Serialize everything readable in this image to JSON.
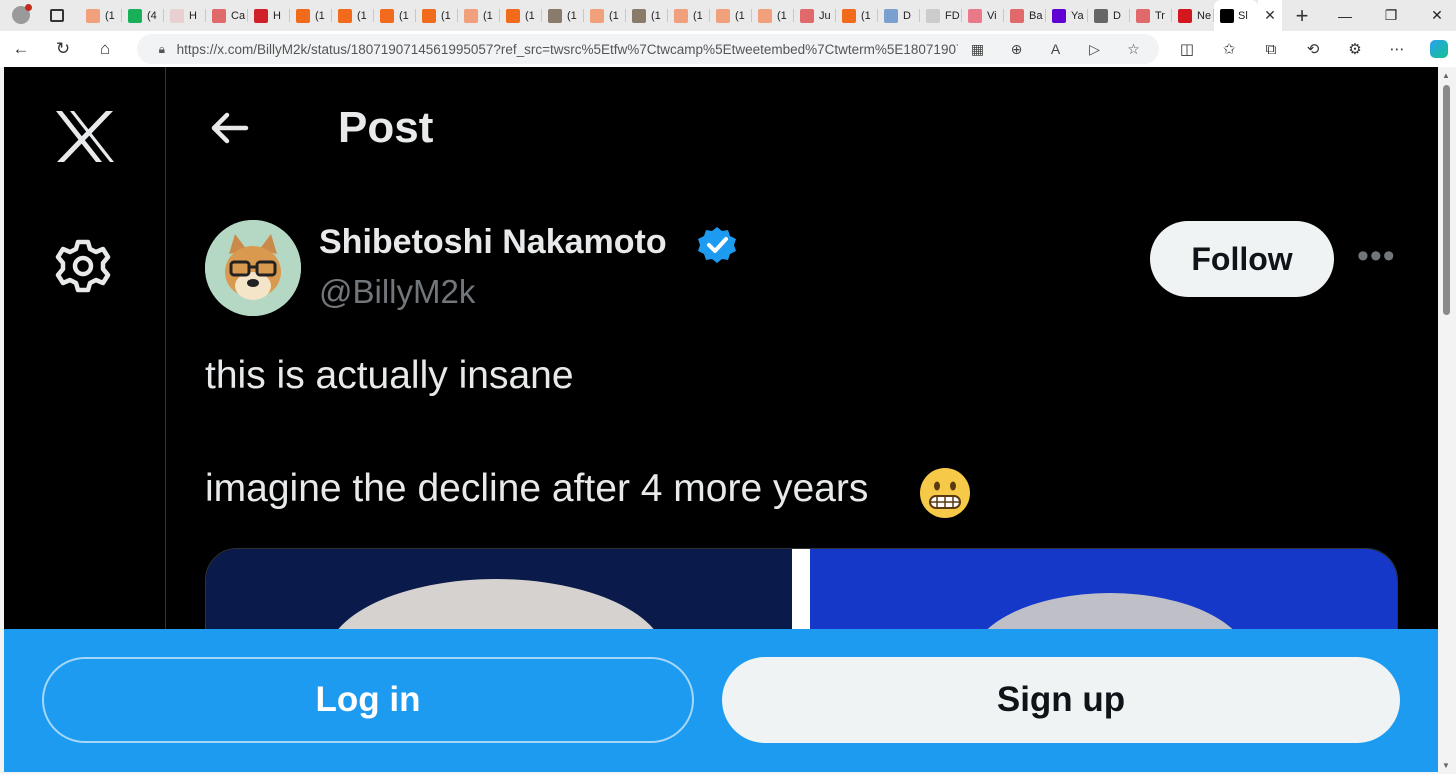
{
  "browser": {
    "tabs": [
      {
        "short": "(1",
        "favicon_color": "#f0a07a"
      },
      {
        "short": "(4",
        "favicon_color": "#18b15a"
      },
      {
        "short": "H",
        "favicon_color": "#e8d0d0"
      },
      {
        "short": "Ca",
        "favicon_color": "#e06a6a"
      },
      {
        "short": "H",
        "favicon_color": "#d0202a"
      },
      {
        "short": "(1",
        "favicon_color": "#f26a1b"
      },
      {
        "short": "(1",
        "favicon_color": "#f26a1b"
      },
      {
        "short": "(1",
        "favicon_color": "#f26a1b"
      },
      {
        "short": "(1",
        "favicon_color": "#f26a1b"
      },
      {
        "short": "(1",
        "favicon_color": "#f0a07a"
      },
      {
        "short": "(1",
        "favicon_color": "#f26a1b"
      },
      {
        "short": "(1",
        "favicon_color": "#8a7a6a"
      },
      {
        "short": "(1",
        "favicon_color": "#f0a07a"
      },
      {
        "short": "(1",
        "favicon_color": "#8a7a6a"
      },
      {
        "short": "(1",
        "favicon_color": "#f0a07a"
      },
      {
        "short": "(1",
        "favicon_color": "#f0a07a"
      },
      {
        "short": "(1",
        "favicon_color": "#f0a07a"
      },
      {
        "short": "Ju",
        "favicon_color": "#e06a6a"
      },
      {
        "short": "(1",
        "favicon_color": "#f26a1b"
      },
      {
        "short": "D",
        "favicon_color": "#7aa0d0"
      },
      {
        "short": "FD",
        "favicon_color": "#cccccc"
      },
      {
        "short": "Vi",
        "favicon_color": "#e87a8a"
      },
      {
        "short": "Ba",
        "favicon_color": "#e06a6a"
      },
      {
        "short": "Ya",
        "favicon_color": "#6001d2"
      },
      {
        "short": "D",
        "favicon_color": "#666666"
      },
      {
        "short": "Tr",
        "favicon_color": "#e06a6a"
      },
      {
        "short": "Ne",
        "favicon_color": "#d4171e"
      }
    ],
    "active_tab": {
      "short": "Sl",
      "favicon_color": "#000000"
    },
    "url": "https://x.com/BillyM2k/status/1807190714561995057?ref_src=twsrc%5Etfw%7Ctwcamp%5Etweetembed%7Ctwterm%5E180719071..."
  },
  "page": {
    "title": "Post"
  },
  "post": {
    "author_name": "Shibetoshi Nakamoto",
    "author_handle": "@BillyM2k",
    "follow_label": "Follow",
    "text_line1": "this is actually insane",
    "text_line2": "imagine the decline after 4 more years"
  },
  "auth": {
    "login_label": "Log in",
    "signup_label": "Sign up"
  },
  "colors": {
    "accent": "#1d9bf0",
    "background": "#000000",
    "text": "#e7e9ea",
    "muted": "#71767b"
  }
}
